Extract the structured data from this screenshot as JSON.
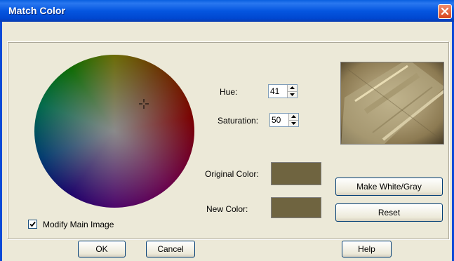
{
  "window": {
    "title": "Match Color",
    "close_icon": "close-x-icon"
  },
  "hue": {
    "label": "Hue:",
    "value": "41"
  },
  "saturation": {
    "label": "Saturation:",
    "value": "50"
  },
  "original_color": {
    "label": "Original Color:",
    "color": "#6f6440"
  },
  "new_color": {
    "label": "New Color:",
    "color": "#6f6440"
  },
  "buttons": {
    "make_white_gray": "Make White/Gray",
    "reset": "Reset",
    "ok": "OK",
    "cancel": "Cancel",
    "help": "Help"
  },
  "modify_main_image": {
    "label": "Modify Main Image",
    "checked": true
  },
  "colors": {
    "title_bar": "#0a5fe0",
    "dialog_bg": "#ece9d8",
    "close_button": "#e0522a"
  }
}
